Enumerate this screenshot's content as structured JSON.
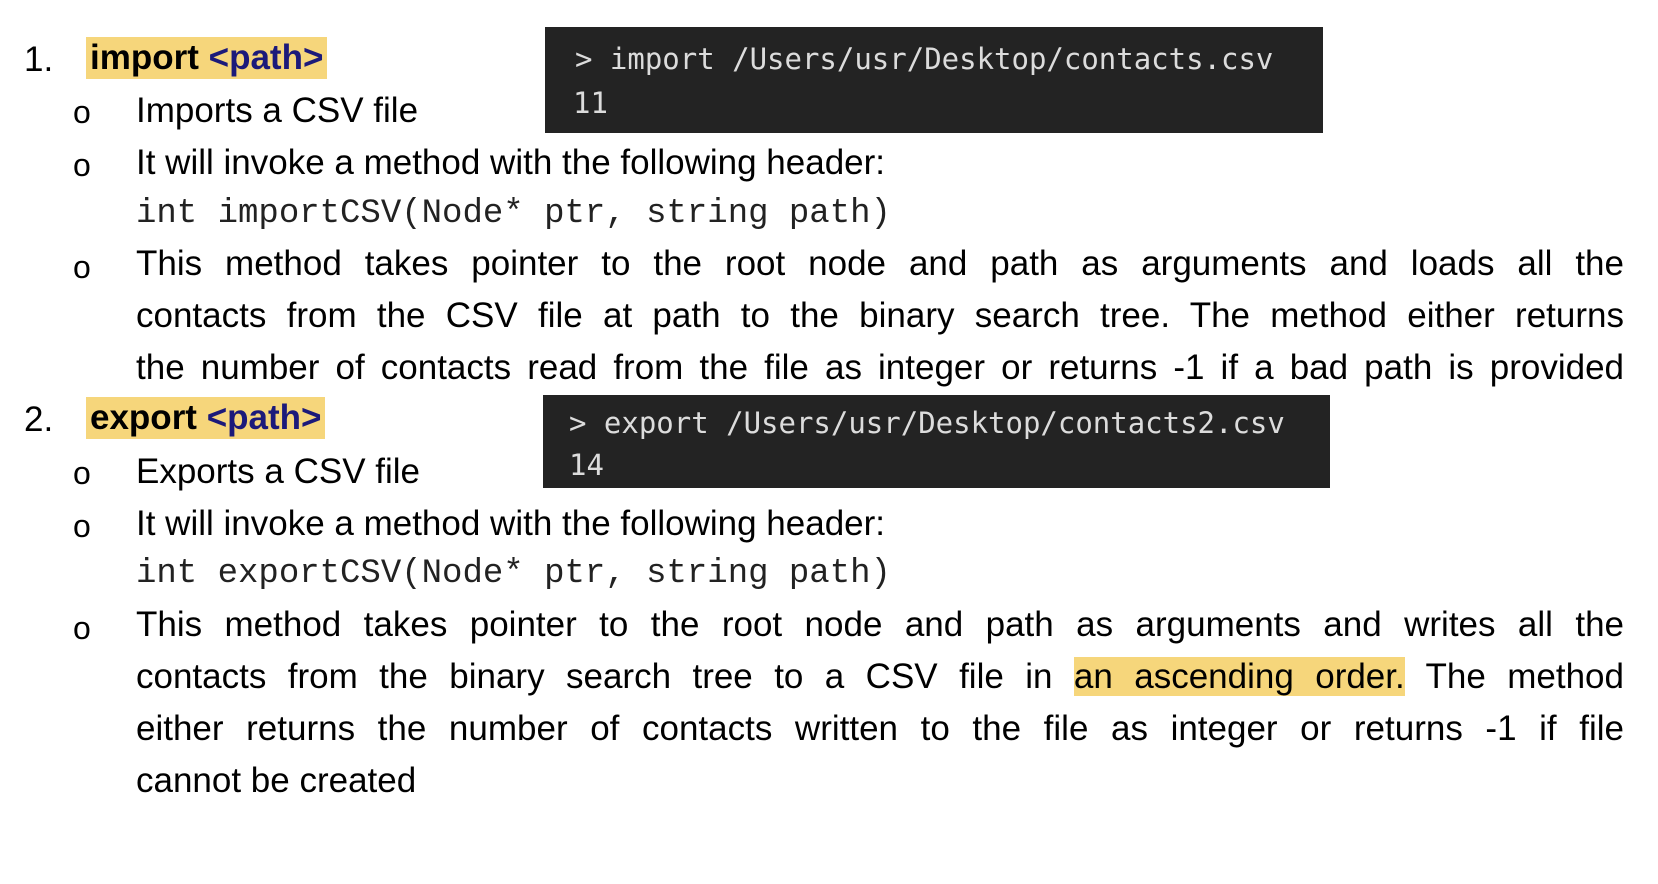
{
  "items": [
    {
      "number": "1.",
      "command": "import",
      "arg": "<path>",
      "terminal": {
        "line1": "> import /Users/usr/Desktop/contacts.csv",
        "line2": "11"
      },
      "bullets": {
        "b1": "Imports a CSV file",
        "b2": "It will invoke a method with the following header:",
        "code": "int importCSV(Node* ptr, string path)",
        "desc_l1": "This method takes pointer to the root node and path as arguments and loads all the",
        "desc_l2": "contacts from the CSV file at path to the binary search tree. The method either returns",
        "desc_l3": "the number of contacts read from the file as integer or returns -1 if a bad path is provided"
      }
    },
    {
      "number": "2.",
      "command": "export",
      "arg": "<path>",
      "terminal": {
        "line1": "> export /Users/usr/Desktop/contacts2.csv",
        "line2": "14"
      },
      "bullets": {
        "b1": "Exports a CSV file",
        "b2": "It will invoke a method with the following header:",
        "code": "int exportCSV(Node* ptr, string path)",
        "desc_l1": "This method takes pointer to the root node and path as arguments and writes all the",
        "desc_l2_pre": "contacts from the binary search tree to a CSV file in ",
        "desc_l2_hl": "an ascending order.",
        "desc_l2_post": " The method",
        "desc_l3": "either returns the number of contacts written to the file as integer or returns -1 if file",
        "desc_l4": "cannot be created"
      }
    }
  ],
  "bullet_glyph": "o",
  "colors": {
    "highlight": "#f6d67b",
    "path_keyword": "#1c1a7a",
    "terminal_bg": "#232323",
    "terminal_text": "#dcdcdc"
  }
}
